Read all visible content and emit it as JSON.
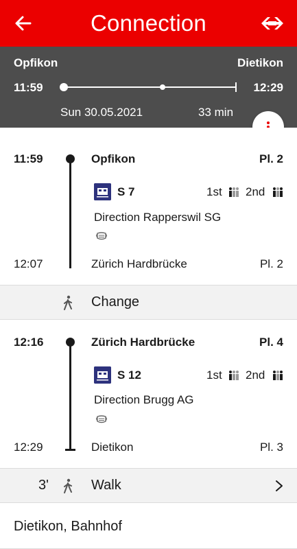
{
  "app_bar": {
    "title": "Connection",
    "back_icon": "back-arrow-icon",
    "logo_icon": "sbb-logo-icon"
  },
  "summary": {
    "from": "Opfikon",
    "to": "Dietikon",
    "departure": "11:59",
    "arrival": "12:29",
    "date": "Sun 30.05.2021",
    "duration": "33 min"
  },
  "menu_icon": "more-vertical-icon",
  "legs": [
    {
      "dep_time": "11:59",
      "dep_station": "Opfikon",
      "dep_platform": "Pl. 2",
      "train": "S 7",
      "first_class": "1st",
      "second_class": "2nd",
      "direction": "Direction Rapperswil SG",
      "arr_time": "12:07",
      "arr_station": "Zürich Hardbrücke",
      "arr_platform": "Pl. 2"
    },
    {
      "dep_time": "12:16",
      "dep_station": "Zürich Hardbrücke",
      "dep_platform": "Pl. 4",
      "train": "S 12",
      "first_class": "1st",
      "second_class": "2nd",
      "direction": "Direction Brugg AG",
      "arr_time": "12:29",
      "arr_station": "Dietikon",
      "arr_platform": "Pl. 3"
    }
  ],
  "change": {
    "label": "Change"
  },
  "walk": {
    "minutes": "3'",
    "label": "Walk"
  },
  "destination": {
    "label": "Dietikon, Bahnhof"
  },
  "colors": {
    "brand_red": "#eb0000",
    "header_gray": "#4d4d4d",
    "train_blue": "#2d327d"
  }
}
